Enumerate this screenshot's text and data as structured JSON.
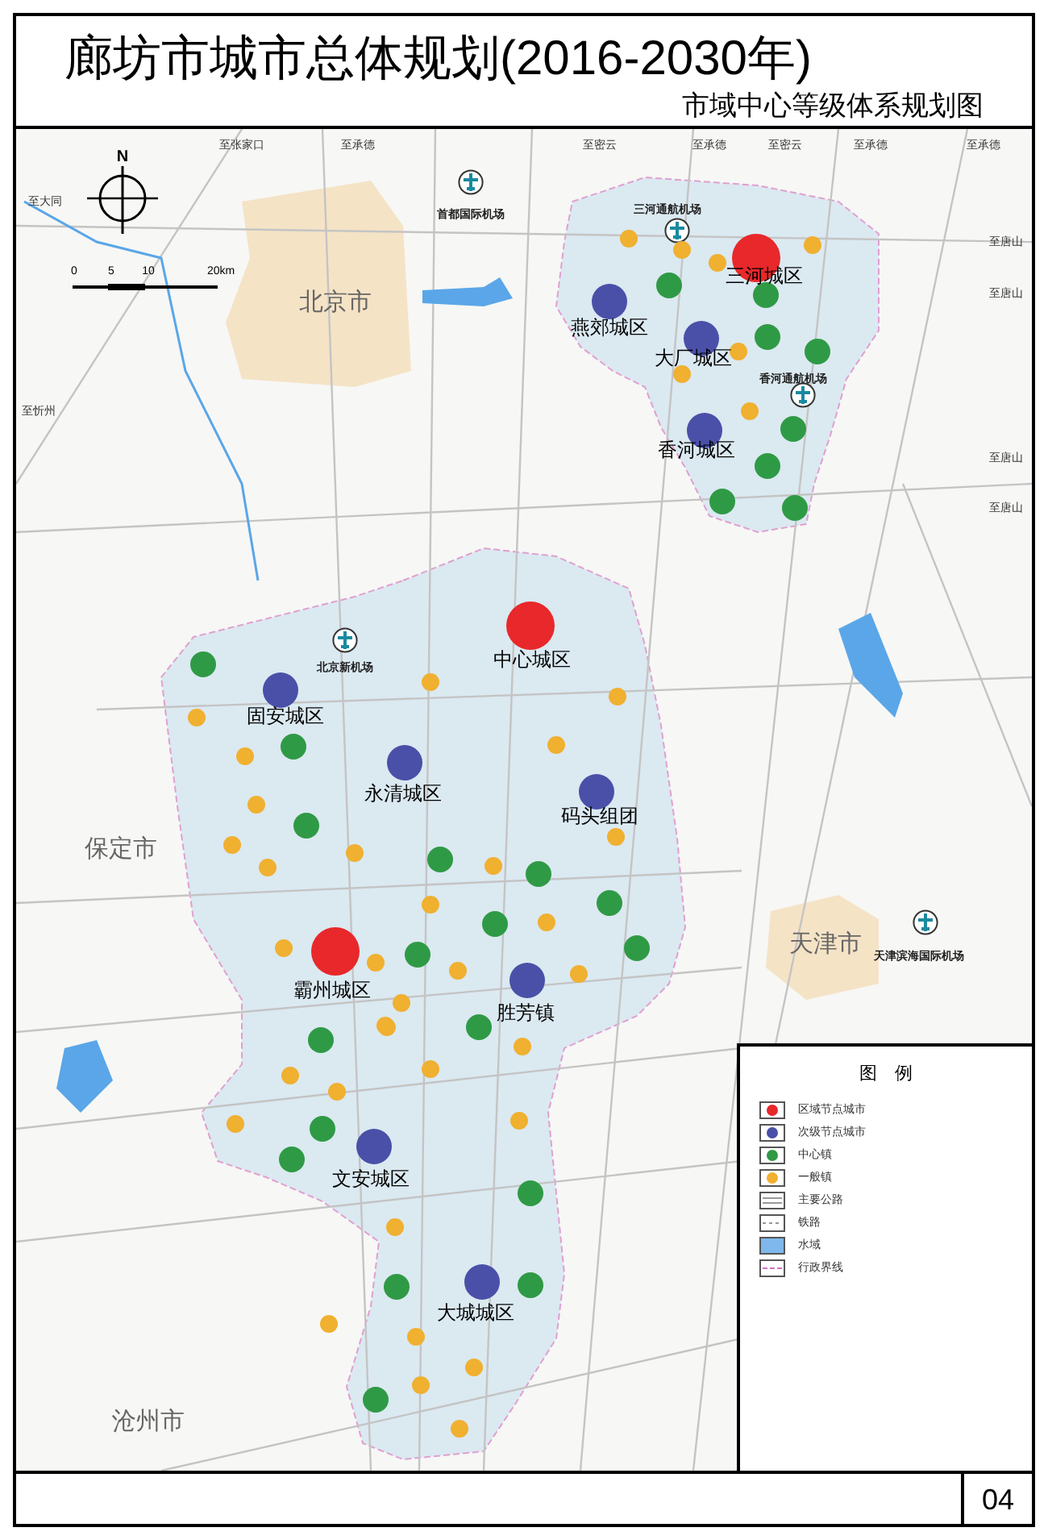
{
  "title": "廊坊市城市总体规划(2016-2030年)",
  "subtitle": "市域中心等级体系规划图",
  "map": {
    "compass": {
      "label": "N"
    },
    "scale": {
      "ticks": [
        "0",
        "5",
        "10",
        "20km"
      ]
    },
    "edge_labels": [
      "至张家口",
      "至承德",
      "至密云",
      "至承德",
      "至密云",
      "至承德",
      "至承德",
      "至大同",
      "至忻州",
      "至唐山",
      "至唐山",
      "至唐山",
      "至唐山"
    ],
    "cities": [
      "北京市",
      "天津市",
      "保定市",
      "沧州市"
    ],
    "airports": [
      {
        "label": "首都国际机场"
      },
      {
        "label": "三河通航机场"
      },
      {
        "label": "香河通航机场"
      },
      {
        "label": "北京新机场"
      },
      {
        "label": "天津滨海国际机场"
      }
    ],
    "nodes": [
      {
        "kind": "regional",
        "label": "三河城区"
      },
      {
        "kind": "secondary",
        "label": "燕郊城区"
      },
      {
        "kind": "secondary",
        "label": "大厂城区"
      },
      {
        "kind": "secondary",
        "label": "香河城区"
      },
      {
        "kind": "regional",
        "label": "中心城区"
      },
      {
        "kind": "secondary",
        "label": "固安城区"
      },
      {
        "kind": "secondary",
        "label": "永清城区"
      },
      {
        "kind": "secondary",
        "label": "码头组团"
      },
      {
        "kind": "regional",
        "label": "霸州城区"
      },
      {
        "kind": "secondary",
        "label": "胜芳镇"
      },
      {
        "kind": "secondary",
        "label": "文安城区"
      },
      {
        "kind": "secondary",
        "label": "大城城区"
      },
      {
        "kind": "central"
      },
      {
        "kind": "central"
      },
      {
        "kind": "central"
      },
      {
        "kind": "central"
      },
      {
        "kind": "central"
      },
      {
        "kind": "central"
      },
      {
        "kind": "central"
      },
      {
        "kind": "central"
      },
      {
        "kind": "central"
      },
      {
        "kind": "central"
      },
      {
        "kind": "central"
      },
      {
        "kind": "central"
      },
      {
        "kind": "central"
      },
      {
        "kind": "central"
      },
      {
        "kind": "central"
      },
      {
        "kind": "central"
      },
      {
        "kind": "central"
      },
      {
        "kind": "central"
      },
      {
        "kind": "central"
      },
      {
        "kind": "central"
      },
      {
        "kind": "central"
      },
      {
        "kind": "central"
      },
      {
        "kind": "central"
      },
      {
        "kind": "central"
      },
      {
        "kind": "central"
      },
      {
        "kind": "general"
      },
      {
        "kind": "general"
      },
      {
        "kind": "general"
      },
      {
        "kind": "general"
      },
      {
        "kind": "general"
      },
      {
        "kind": "general"
      },
      {
        "kind": "general"
      },
      {
        "kind": "general"
      },
      {
        "kind": "general"
      },
      {
        "kind": "general"
      },
      {
        "kind": "general"
      },
      {
        "kind": "general"
      },
      {
        "kind": "general"
      },
      {
        "kind": "general"
      },
      {
        "kind": "general"
      },
      {
        "kind": "general"
      },
      {
        "kind": "general"
      },
      {
        "kind": "general"
      },
      {
        "kind": "general"
      },
      {
        "kind": "general"
      },
      {
        "kind": "general"
      },
      {
        "kind": "general"
      },
      {
        "kind": "general"
      },
      {
        "kind": "general"
      },
      {
        "kind": "general"
      },
      {
        "kind": "general"
      },
      {
        "kind": "general"
      },
      {
        "kind": "general"
      },
      {
        "kind": "general"
      },
      {
        "kind": "general"
      },
      {
        "kind": "general"
      },
      {
        "kind": "general"
      },
      {
        "kind": "general"
      },
      {
        "kind": "general"
      },
      {
        "kind": "general"
      },
      {
        "kind": "general"
      },
      {
        "kind": "general"
      },
      {
        "kind": "general"
      },
      {
        "kind": "general"
      }
    ],
    "legend": {
      "title": "图　例",
      "items": [
        {
          "kind": "regional",
          "label": "区域节点城市"
        },
        {
          "kind": "secondary",
          "label": "次级节点城市"
        },
        {
          "kind": "central",
          "label": "中心镇"
        },
        {
          "kind": "general",
          "label": "一般镇"
        },
        {
          "kind": "road",
          "label": "主要公路"
        },
        {
          "kind": "rail",
          "label": "铁路"
        },
        {
          "kind": "water",
          "label": "水域"
        },
        {
          "kind": "boundary",
          "label": "行政界线"
        }
      ]
    }
  },
  "page_number": "04"
}
